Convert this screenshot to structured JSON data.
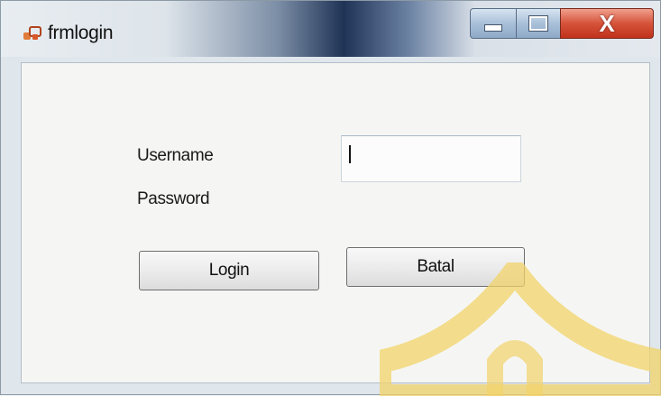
{
  "window": {
    "title": "frmlogin",
    "icon": "form-app-icon",
    "controls": {
      "minimize_icon": "minimize-icon",
      "maximize_icon": "maximize-icon",
      "close_icon": "close-icon",
      "close_glyph": "X"
    }
  },
  "form": {
    "username_label": "Username",
    "password_label": "Password",
    "username_value": "",
    "login_button": "Login",
    "cancel_button": "Batal"
  },
  "colors": {
    "close_button": "#c0321c",
    "watermark": "#f2d36a"
  }
}
